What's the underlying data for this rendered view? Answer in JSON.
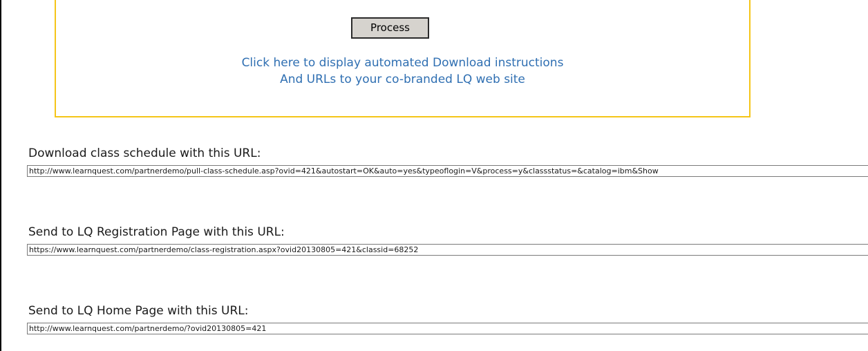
{
  "process_button": {
    "label": "Process"
  },
  "instructions_link": {
    "line1": "Click here to display automated Download instructions",
    "line2": "And URLs to your co-branded LQ web site"
  },
  "fields": [
    {
      "label": "Download class schedule with this URL:",
      "value": "http://www.learnquest.com/partnerdemo/pull-class-schedule.asp?ovid=421&autostart=OK&auto=yes&typeoflogin=V&process=y&classstatus=&catalog=ibm&Show"
    },
    {
      "label": "Send to LQ Registration Page with this URL:",
      "value": "https://www.learnquest.com/partnerdemo/class-registration.aspx?ovid20130805=421&classid=68252"
    },
    {
      "label": "Send to LQ Home Page with this URL:",
      "value": "http://www.learnquest.com/partnerdemo/?ovid20130805=421"
    }
  ],
  "colors": {
    "link": "#2f6fb2",
    "box_border": "#f5c518",
    "button_bg": "#d6d3ce"
  }
}
